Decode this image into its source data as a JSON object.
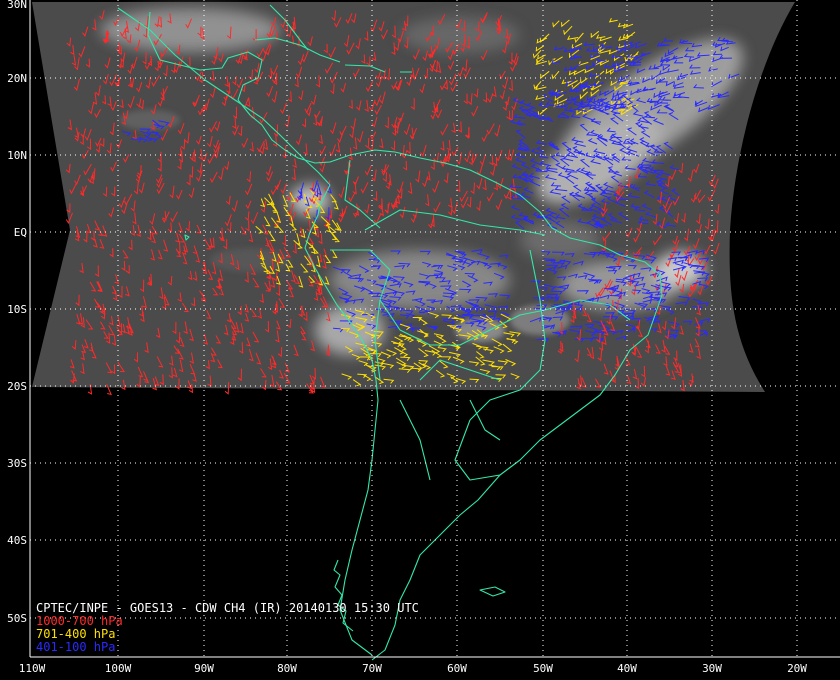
{
  "title": "CPTEC/INPE - GOES13 - CDW CH4 (IR) 20140130 15:30 UTC",
  "legend": [
    {
      "label": "1000-700 hPa",
      "color": "#ff2a2a"
    },
    {
      "label": "701-400 hPa",
      "color": "#ffe000"
    },
    {
      "label": "401-100 hPa",
      "color": "#2a2aff"
    }
  ],
  "lat_labels": [
    "30N",
    "20N",
    "10N",
    "EQ",
    "10S",
    "20S",
    "30S",
    "40S",
    "50S"
  ],
  "lon_labels": [
    "110W",
    "100W",
    "90W",
    "80W",
    "70W",
    "60W",
    "50W",
    "40W",
    "30W",
    "20W"
  ],
  "colors": {
    "coast": "#33e8a8",
    "grid": "#ffffff",
    "background": "#000000"
  }
}
